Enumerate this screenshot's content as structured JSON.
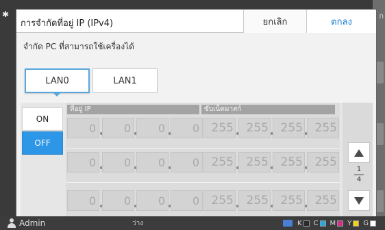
{
  "dialog": {
    "title": "การจำกัดที่อยู่ IP (IPv4)",
    "cancel_label": "ยกเลิก",
    "ok_label": "ตกลง",
    "subtitle": "จำกัด PC ที่สามารถใช้เครื่องได้"
  },
  "tabs": [
    {
      "label": "LAN0",
      "active": true
    },
    {
      "label": "LAN1",
      "active": false
    }
  ],
  "toggle": {
    "on_label": "ON",
    "off_label": "OFF",
    "selected": "OFF"
  },
  "columns": {
    "ip_header": "ที่อยู่ IP",
    "mask_header": "ซับเน็ตมาสก์"
  },
  "rows": [
    {
      "ip": [
        "0",
        "0",
        "0",
        "0"
      ],
      "mask": [
        "255",
        "255",
        "255",
        "255"
      ]
    },
    {
      "ip": [
        "0",
        "0",
        "0",
        "0"
      ],
      "mask": [
        "255",
        "255",
        "255",
        "255"
      ]
    },
    {
      "ip": [
        "0",
        "0",
        "0",
        "0"
      ],
      "mask": [
        "255",
        "255",
        "255",
        "255"
      ]
    }
  ],
  "pager": {
    "current": "1",
    "total": "4"
  },
  "status_bar": {
    "user": "Admin",
    "center_text": "ว่าง",
    "inks": [
      {
        "label": "K",
        "color": "#2b2b2b"
      },
      {
        "label": "C",
        "color": "#2aa8e0"
      },
      {
        "label": "M",
        "color": "#d2308a"
      },
      {
        "label": "Y",
        "color": "#f2d21b"
      },
      {
        "label": "G",
        "color": "#ffffff"
      }
    ]
  },
  "background": {
    "right_text": "ก"
  },
  "colors": {
    "accent": "#2e96e6",
    "ok_text": "#1b7bd3",
    "tab_border": "#58a6e0"
  }
}
